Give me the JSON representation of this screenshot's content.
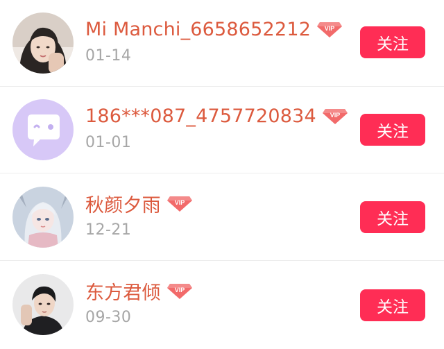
{
  "colors": {
    "name": "#dc5a3e",
    "date": "#a6a6a6",
    "follow_button": "#ff2d55",
    "vip_badge": "#f26a6a"
  },
  "users": [
    {
      "name": "Mi Manchi_6658652212",
      "date": "01-14",
      "button": "关注",
      "vip_label": "VIP",
      "avatar": "photo-girl-avatar"
    },
    {
      "name": "186***087_4757720834",
      "date": "01-01",
      "button": "关注",
      "vip_label": "VIP",
      "avatar": "default-chat-bubble-avatar"
    },
    {
      "name": "秋颜夕雨",
      "date": "12-21",
      "button": "关注",
      "vip_label": "VIP",
      "avatar": "anime-girl-avatar"
    },
    {
      "name": "东方君倾",
      "date": "09-30",
      "button": "关注",
      "vip_label": "VIP",
      "avatar": "photo-man-avatar"
    }
  ]
}
